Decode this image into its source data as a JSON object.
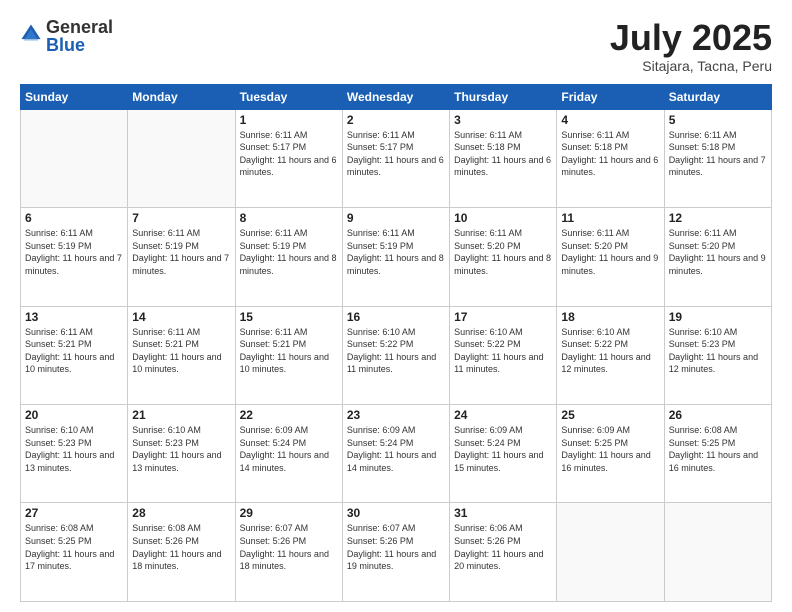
{
  "logo": {
    "general": "General",
    "blue": "Blue"
  },
  "title": "July 2025",
  "subtitle": "Sitajara, Tacna, Peru",
  "weekdays": [
    "Sunday",
    "Monday",
    "Tuesday",
    "Wednesday",
    "Thursday",
    "Friday",
    "Saturday"
  ],
  "weeks": [
    [
      {
        "day": "",
        "info": ""
      },
      {
        "day": "",
        "info": ""
      },
      {
        "day": "1",
        "info": "Sunrise: 6:11 AM\nSunset: 5:17 PM\nDaylight: 11 hours and 6 minutes."
      },
      {
        "day": "2",
        "info": "Sunrise: 6:11 AM\nSunset: 5:17 PM\nDaylight: 11 hours and 6 minutes."
      },
      {
        "day": "3",
        "info": "Sunrise: 6:11 AM\nSunset: 5:18 PM\nDaylight: 11 hours and 6 minutes."
      },
      {
        "day": "4",
        "info": "Sunrise: 6:11 AM\nSunset: 5:18 PM\nDaylight: 11 hours and 6 minutes."
      },
      {
        "day": "5",
        "info": "Sunrise: 6:11 AM\nSunset: 5:18 PM\nDaylight: 11 hours and 7 minutes."
      }
    ],
    [
      {
        "day": "6",
        "info": "Sunrise: 6:11 AM\nSunset: 5:19 PM\nDaylight: 11 hours and 7 minutes."
      },
      {
        "day": "7",
        "info": "Sunrise: 6:11 AM\nSunset: 5:19 PM\nDaylight: 11 hours and 7 minutes."
      },
      {
        "day": "8",
        "info": "Sunrise: 6:11 AM\nSunset: 5:19 PM\nDaylight: 11 hours and 8 minutes."
      },
      {
        "day": "9",
        "info": "Sunrise: 6:11 AM\nSunset: 5:19 PM\nDaylight: 11 hours and 8 minutes."
      },
      {
        "day": "10",
        "info": "Sunrise: 6:11 AM\nSunset: 5:20 PM\nDaylight: 11 hours and 8 minutes."
      },
      {
        "day": "11",
        "info": "Sunrise: 6:11 AM\nSunset: 5:20 PM\nDaylight: 11 hours and 9 minutes."
      },
      {
        "day": "12",
        "info": "Sunrise: 6:11 AM\nSunset: 5:20 PM\nDaylight: 11 hours and 9 minutes."
      }
    ],
    [
      {
        "day": "13",
        "info": "Sunrise: 6:11 AM\nSunset: 5:21 PM\nDaylight: 11 hours and 10 minutes."
      },
      {
        "day": "14",
        "info": "Sunrise: 6:11 AM\nSunset: 5:21 PM\nDaylight: 11 hours and 10 minutes."
      },
      {
        "day": "15",
        "info": "Sunrise: 6:11 AM\nSunset: 5:21 PM\nDaylight: 11 hours and 10 minutes."
      },
      {
        "day": "16",
        "info": "Sunrise: 6:10 AM\nSunset: 5:22 PM\nDaylight: 11 hours and 11 minutes."
      },
      {
        "day": "17",
        "info": "Sunrise: 6:10 AM\nSunset: 5:22 PM\nDaylight: 11 hours and 11 minutes."
      },
      {
        "day": "18",
        "info": "Sunrise: 6:10 AM\nSunset: 5:22 PM\nDaylight: 11 hours and 12 minutes."
      },
      {
        "day": "19",
        "info": "Sunrise: 6:10 AM\nSunset: 5:23 PM\nDaylight: 11 hours and 12 minutes."
      }
    ],
    [
      {
        "day": "20",
        "info": "Sunrise: 6:10 AM\nSunset: 5:23 PM\nDaylight: 11 hours and 13 minutes."
      },
      {
        "day": "21",
        "info": "Sunrise: 6:10 AM\nSunset: 5:23 PM\nDaylight: 11 hours and 13 minutes."
      },
      {
        "day": "22",
        "info": "Sunrise: 6:09 AM\nSunset: 5:24 PM\nDaylight: 11 hours and 14 minutes."
      },
      {
        "day": "23",
        "info": "Sunrise: 6:09 AM\nSunset: 5:24 PM\nDaylight: 11 hours and 14 minutes."
      },
      {
        "day": "24",
        "info": "Sunrise: 6:09 AM\nSunset: 5:24 PM\nDaylight: 11 hours and 15 minutes."
      },
      {
        "day": "25",
        "info": "Sunrise: 6:09 AM\nSunset: 5:25 PM\nDaylight: 11 hours and 16 minutes."
      },
      {
        "day": "26",
        "info": "Sunrise: 6:08 AM\nSunset: 5:25 PM\nDaylight: 11 hours and 16 minutes."
      }
    ],
    [
      {
        "day": "27",
        "info": "Sunrise: 6:08 AM\nSunset: 5:25 PM\nDaylight: 11 hours and 17 minutes."
      },
      {
        "day": "28",
        "info": "Sunrise: 6:08 AM\nSunset: 5:26 PM\nDaylight: 11 hours and 18 minutes."
      },
      {
        "day": "29",
        "info": "Sunrise: 6:07 AM\nSunset: 5:26 PM\nDaylight: 11 hours and 18 minutes."
      },
      {
        "day": "30",
        "info": "Sunrise: 6:07 AM\nSunset: 5:26 PM\nDaylight: 11 hours and 19 minutes."
      },
      {
        "day": "31",
        "info": "Sunrise: 6:06 AM\nSunset: 5:26 PM\nDaylight: 11 hours and 20 minutes."
      },
      {
        "day": "",
        "info": ""
      },
      {
        "day": "",
        "info": ""
      }
    ]
  ]
}
